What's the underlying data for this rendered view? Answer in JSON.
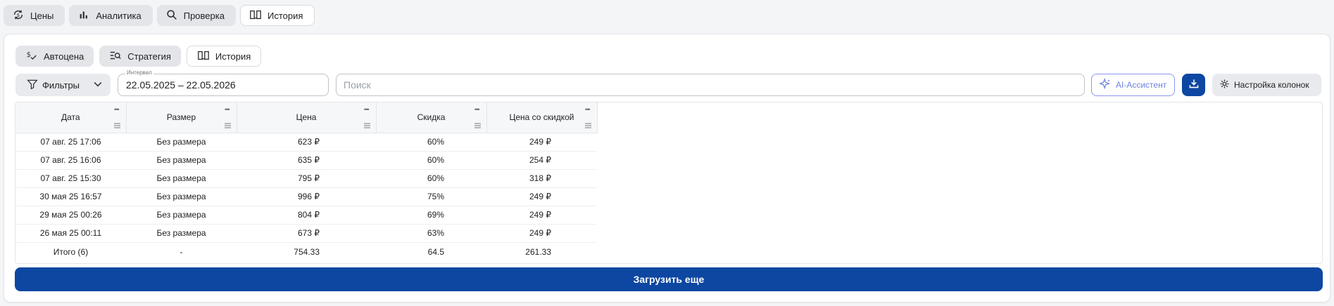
{
  "top_tabs": [
    {
      "label": "Цены",
      "icon": "price-refresh-icon"
    },
    {
      "label": "Аналитика",
      "icon": "bar-chart-icon"
    },
    {
      "label": "Проверка",
      "icon": "search-icon"
    },
    {
      "label": "История",
      "icon": "book-icon"
    }
  ],
  "sub_tabs": [
    {
      "label": "Автоцена",
      "icon": "dollar-check-icon"
    },
    {
      "label": "Стратегия",
      "icon": "list-search-icon"
    },
    {
      "label": "История",
      "icon": "book-icon"
    }
  ],
  "toolbar": {
    "filters_label": "Фильтры",
    "interval_label": "Интервал",
    "interval_value": "22.05.2025 – 22.05.2026",
    "search_placeholder": "Поиск",
    "ai_label": "AI-Ассистент",
    "columns_label": "Настройка колонок"
  },
  "table": {
    "columns": [
      "Дата",
      "Размер",
      "Цена",
      "Скидка",
      "Цена со скидкой"
    ],
    "rows": [
      [
        "07 авг. 25 17:06",
        "Без размера",
        "623 ₽",
        "60%",
        "249 ₽"
      ],
      [
        "07 авг. 25 16:06",
        "Без размера",
        "635 ₽",
        "60%",
        "254 ₽"
      ],
      [
        "07 авг. 25 15:30",
        "Без размера",
        "795 ₽",
        "60%",
        "318 ₽"
      ],
      [
        "30 мая 25 16:57",
        "Без размера",
        "996 ₽",
        "75%",
        "249 ₽"
      ],
      [
        "29 мая 25 00:26",
        "Без размера",
        "804 ₽",
        "69%",
        "249 ₽"
      ],
      [
        "26 мая 25 00:11",
        "Без размера",
        "673 ₽",
        "63%",
        "249 ₽"
      ]
    ],
    "total": [
      "Итого (6)",
      "-",
      "754.33",
      "64.5",
      "261.33"
    ]
  },
  "load_more_label": "Загрузить еще",
  "colors": {
    "accent": "#0d47a1",
    "ai": "#6f82e0"
  }
}
